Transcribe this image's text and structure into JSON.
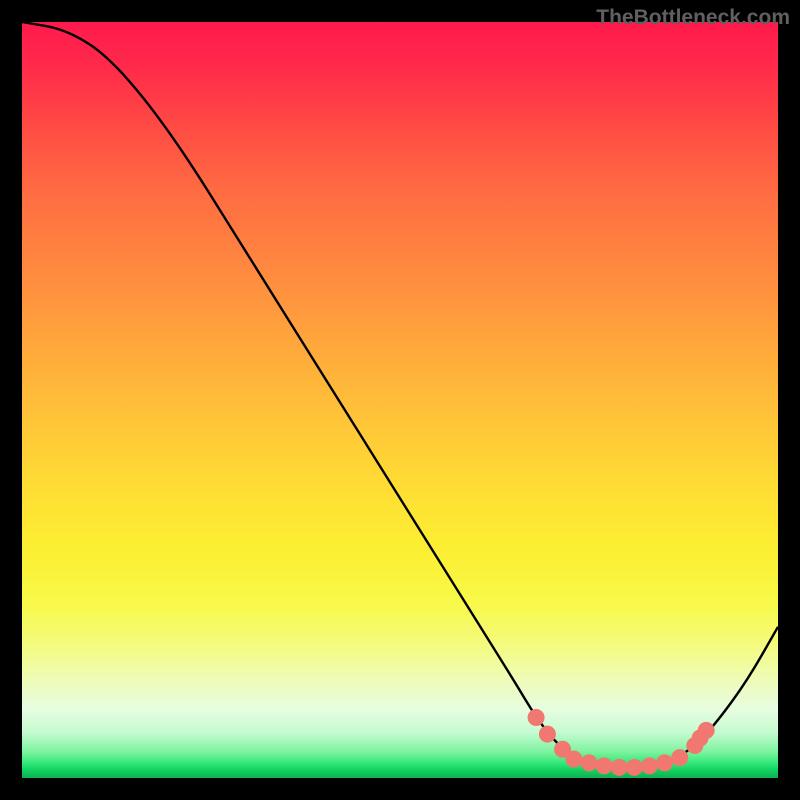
{
  "watermark": "TheBottleneck.com",
  "chart_data": {
    "type": "line",
    "title": "",
    "xlabel": "",
    "ylabel": "",
    "xlim": [
      0,
      100
    ],
    "ylim": [
      0,
      100
    ],
    "curve_points": [
      {
        "x": 0,
        "y": 100
      },
      {
        "x": 6,
        "y": 99
      },
      {
        "x": 12,
        "y": 95
      },
      {
        "x": 20,
        "y": 85
      },
      {
        "x": 30,
        "y": 69
      },
      {
        "x": 40,
        "y": 53
      },
      {
        "x": 50,
        "y": 37
      },
      {
        "x": 60,
        "y": 21
      },
      {
        "x": 65,
        "y": 13
      },
      {
        "x": 68,
        "y": 8
      },
      {
        "x": 71,
        "y": 4.2
      },
      {
        "x": 74,
        "y": 2.3
      },
      {
        "x": 77,
        "y": 1.5
      },
      {
        "x": 80,
        "y": 1.3
      },
      {
        "x": 83,
        "y": 1.5
      },
      {
        "x": 86,
        "y": 2.3
      },
      {
        "x": 89,
        "y": 4.2
      },
      {
        "x": 92,
        "y": 7.5
      },
      {
        "x": 96,
        "y": 13
      },
      {
        "x": 100,
        "y": 20
      }
    ],
    "dots": [
      {
        "x": 68,
        "y": 8.0
      },
      {
        "x": 69.5,
        "y": 5.8
      },
      {
        "x": 71.5,
        "y": 3.8
      },
      {
        "x": 73,
        "y": 2.5
      },
      {
        "x": 75,
        "y": 2.0
      },
      {
        "x": 77,
        "y": 1.6
      },
      {
        "x": 79,
        "y": 1.4
      },
      {
        "x": 81,
        "y": 1.4
      },
      {
        "x": 83,
        "y": 1.6
      },
      {
        "x": 85,
        "y": 2.0
      },
      {
        "x": 87,
        "y": 2.7
      },
      {
        "x": 89,
        "y": 4.3
      },
      {
        "x": 89.7,
        "y": 5.3
      },
      {
        "x": 90.5,
        "y": 6.3
      }
    ],
    "dot_color": "#f07870",
    "curve_color": "#000000",
    "gradient_stops": [
      {
        "pos": 0,
        "color": "#ff1a4d"
      },
      {
        "pos": 50,
        "color": "#ffd038"
      },
      {
        "pos": 85,
        "color": "#f0fca0"
      },
      {
        "pos": 100,
        "color": "#0fb050"
      }
    ]
  }
}
